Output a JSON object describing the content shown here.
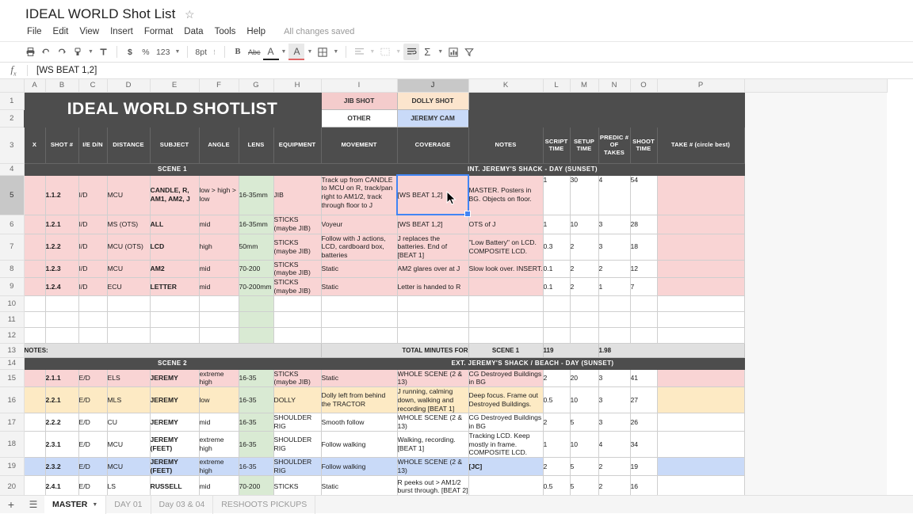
{
  "app": {
    "title": "IDEAL WORLD Shot List",
    "star_icon": "star-outline",
    "save_status": "All changes saved"
  },
  "menubar": [
    "File",
    "Edit",
    "View",
    "Insert",
    "Format",
    "Data",
    "Tools",
    "Help"
  ],
  "toolbar": {
    "items": [
      {
        "name": "print-icon",
        "glyph": "⎙"
      },
      {
        "name": "undo-icon",
        "glyph": "↶"
      },
      {
        "name": "redo-icon",
        "glyph": "↷"
      },
      {
        "name": "paint-format-icon",
        "glyph": "⎙"
      },
      {
        "name": "zoom-dropdown",
        "glyph": "▾"
      },
      {
        "name": "format-brush-icon",
        "glyph": "ᵀ"
      }
    ],
    "currency_label": "$",
    "percent_label": "%",
    "number_format_label": "123",
    "font_size_label": "8pt",
    "bold_label": "B",
    "strikethrough_label": "Abc",
    "text_color_label": "A",
    "fill_color_label": "A",
    "borders_icon": "borders-icon",
    "align_icon": "align-left-icon",
    "merge_icon": "merge-cells-icon",
    "wrap_icon": "text-wrap-icon",
    "functions_label": "Σ",
    "chart_icon": "insert-chart-icon",
    "filter_icon": "filter-icon"
  },
  "formula_bar": {
    "fx_label": "fx",
    "value": "[WS BEAT 1,2]"
  },
  "grid": {
    "column_letters": [
      "A",
      "B",
      "C",
      "D",
      "E",
      "F",
      "G",
      "H",
      "I",
      "J",
      "K",
      "L",
      "M",
      "N",
      "O",
      "P"
    ],
    "selected_column": "J",
    "selected_row": 5,
    "row_numbers": [
      1,
      2,
      3,
      4,
      5,
      6,
      7,
      8,
      9,
      10,
      11,
      12,
      13,
      14,
      15,
      16,
      17,
      18,
      19,
      20
    ]
  },
  "banner": {
    "title": "IDEAL WORLD SHOTLIST"
  },
  "legend": [
    {
      "label": "JIB SHOT",
      "color": "#f4cccc"
    },
    {
      "label": "DOLLY SHOT",
      "color": "#fce5cd"
    },
    {
      "label": "OTHER",
      "color": "#ffffff"
    },
    {
      "label": "JEREMY CAM",
      "color": "#c9daf8"
    }
  ],
  "headers": [
    "X",
    "SHOT #",
    "I/E D/N",
    "DISTANCE",
    "SUBJECT",
    "ANGLE",
    "LENS",
    "EQUIPMENT",
    "MOVEMENT",
    "COVERAGE",
    "NOTES",
    "SCRIPT TIME",
    "SETUP TIME",
    "PREDIC # OF TAKES",
    "SHOOT TIME",
    "TAKE # (circle best)"
  ],
  "scene1": {
    "label": "SCENE 1",
    "location": "INT. JEREMY'S SHACK - DAY (SUNSET)",
    "rows": [
      {
        "fill": "pink",
        "shot": "1.1.2",
        "ied": "I/D",
        "distance": "MCU",
        "subject": "CANDLE, R, AM1, AM2, J",
        "angle": "low > high > low",
        "lens": "16-35mm",
        "equipment": "JIB",
        "movement": "Track up from CANDLE to MCU on R, track/pan right to AM1/2, track through floor to J",
        "coverage": "[WS BEAT 1,2]",
        "notes": "MASTER. Posters in BG. Objects on floor.",
        "script_time": "1",
        "setup_time": "30",
        "takes": "4",
        "shoot_time": "54",
        "take_num": ""
      },
      {
        "fill": "pink",
        "shot": "1.2.1",
        "ied": "I/D",
        "distance": "MS (OTS)",
        "subject": "ALL",
        "angle": "mid",
        "lens": "16-35mm",
        "equipment": "STICKS (maybe JIB)",
        "movement": "Voyeur",
        "coverage": "[WS BEAT 1,2]",
        "notes": "OTS of J",
        "script_time": "1",
        "setup_time": "10",
        "takes": "3",
        "shoot_time": "28",
        "take_num": ""
      },
      {
        "fill": "pink",
        "shot": "1.2.2",
        "ied": "I/D",
        "distance": "MCU (OTS)",
        "subject": "LCD",
        "angle": "high",
        "lens": "50mm",
        "equipment": "STICKS (maybe JIB)",
        "movement": "Follow with J actions, LCD, cardboard box, batteries",
        "coverage": "J replaces the batteries. End of [BEAT 1]",
        "notes": "\"Low Battery\" on LCD. COMPOSITE LCD.",
        "script_time": "0.3",
        "setup_time": "2",
        "takes": "3",
        "shoot_time": "18",
        "take_num": ""
      },
      {
        "fill": "pink",
        "shot": "1.2.3",
        "ied": "I/D",
        "distance": "MCU",
        "subject": "AM2",
        "angle": "mid",
        "lens": "70-200",
        "equipment": "STICKS (maybe JIB)",
        "movement": "Static",
        "coverage": "AM2 glares over at J",
        "notes": "Slow look over. INSERT.",
        "script_time": "0.1",
        "setup_time": "2",
        "takes": "2",
        "shoot_time": "12",
        "take_num": ""
      },
      {
        "fill": "pink",
        "shot": "1.2.4",
        "ied": "I/D",
        "distance": "ECU",
        "subject": "LETTER",
        "angle": "mid",
        "lens": "70-200mm",
        "equipment": "STICKS (maybe JIB)",
        "movement": "Static",
        "coverage": "Letter is handed to R",
        "notes": "",
        "script_time": "0.1",
        "setup_time": "2",
        "takes": "1",
        "shoot_time": "7",
        "take_num": ""
      }
    ],
    "totals": {
      "notes_label": "NOTES:",
      "total_label": "TOTAL MINUTES FOR",
      "scene_label": "SCENE 1",
      "minutes": "119",
      "hours": "1.98"
    }
  },
  "scene2": {
    "label": "SCENE 2",
    "location": "EXT. JEREMY'S SHACK / BEACH - DAY (SUNSET)",
    "rows": [
      {
        "fill": "pink",
        "shot": "2.1.1",
        "ied": "E/D",
        "distance": "ELS",
        "subject": "JEREMY",
        "angle": "extreme high",
        "lens": "16-35",
        "equipment": "STICKS (maybe JIB)",
        "movement": "Static",
        "coverage": "WHOLE SCENE (2 & 13)",
        "notes": "CG Destroyed Buildings in BG",
        "script_time": "2",
        "setup_time": "20",
        "takes": "3",
        "shoot_time": "41",
        "take_num": ""
      },
      {
        "fill": "cream",
        "shot": "2.2.1",
        "ied": "E/D",
        "distance": "MLS",
        "subject": "JEREMY",
        "angle": "low",
        "lens": "16-35",
        "equipment": "DOLLY",
        "movement": "Dolly left from behind the TRACTOR",
        "coverage": "J running, calming down, walking and recording [BEAT 1]",
        "notes": "Deep focus. Frame out Destroyed Buildings.",
        "script_time": "0.5",
        "setup_time": "10",
        "takes": "3",
        "shoot_time": "27",
        "take_num": ""
      },
      {
        "fill": "white",
        "shot": "2.2.2",
        "ied": "E/D",
        "distance": "CU",
        "subject": "JEREMY",
        "angle": "mid",
        "lens": "16-35",
        "equipment": "SHOULDER RIG",
        "movement": "Smooth follow",
        "coverage": "WHOLE SCENE (2 & 13)",
        "notes": "CG Destroyed Buildings in BG",
        "script_time": "2",
        "setup_time": "5",
        "takes": "3",
        "shoot_time": "26",
        "take_num": ""
      },
      {
        "fill": "white",
        "shot": "2.3.1",
        "ied": "E/D",
        "distance": "MCU",
        "subject": "JEREMY (FEET)",
        "angle": "extreme high",
        "lens": "16-35",
        "equipment": "SHOULDER RIG",
        "movement": "Follow walking",
        "coverage": "Walking, recording. [BEAT 1]",
        "notes": "Tracking LCD. Keep mostly in frame. COMPOSITE LCD.",
        "script_time": "1",
        "setup_time": "10",
        "takes": "4",
        "shoot_time": "34",
        "take_num": ""
      },
      {
        "fill": "blue",
        "shot": "2.3.2",
        "ied": "E/D",
        "distance": "MCU",
        "subject": "JEREMY (FEET)",
        "angle": "extreme high",
        "lens": "16-35",
        "equipment": "SHOULDER RIG",
        "movement": "Follow walking",
        "coverage": "WHOLE SCENE (2 & 13)",
        "notes": "[JC]",
        "script_time": "2",
        "setup_time": "5",
        "takes": "2",
        "shoot_time": "19",
        "take_num": ""
      },
      {
        "fill": "white",
        "shot": "2.4.1",
        "ied": "E/D",
        "distance": "LS",
        "subject": "RUSSELL",
        "angle": "mid",
        "lens": "70-200",
        "equipment": "STICKS",
        "movement": "Static",
        "coverage": "R peeks out > AM1/2 burst through. [BEAT 2]",
        "notes": "",
        "script_time": "0.5",
        "setup_time": "5",
        "takes": "2",
        "shoot_time": "16",
        "take_num": ""
      }
    ]
  },
  "sheet_tabs": {
    "add_icon": "add-sheet-icon",
    "list_icon": "all-sheets-icon",
    "tabs": [
      {
        "label": "MASTER",
        "active": true
      },
      {
        "label": "DAY 01",
        "active": false
      },
      {
        "label": "Day 03 & 04",
        "active": false
      },
      {
        "label": "RESHOOTS PICKUPS",
        "active": false
      }
    ]
  }
}
